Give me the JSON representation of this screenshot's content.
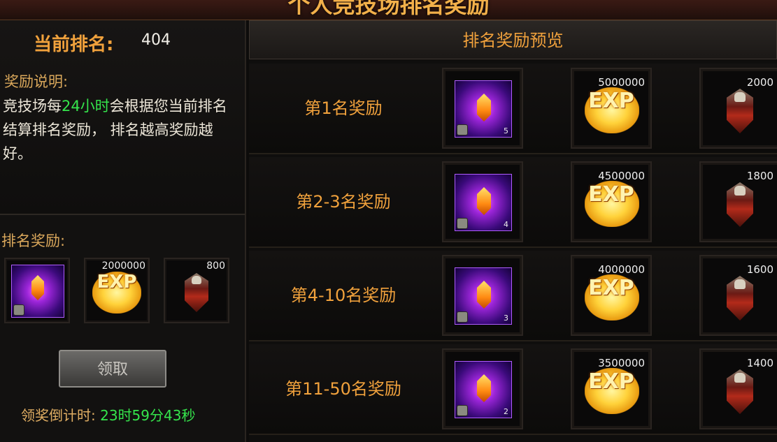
{
  "header": {
    "title": "个人竞技场排名奖励"
  },
  "left": {
    "rank_label": "当前排名:",
    "rank_value": "404",
    "desc_title": "奖励说明:",
    "desc_pre": "竞技场每",
    "desc_highlight": "24小时",
    "desc_post": "会根据您当前排名结算排名奖励， 排名越高奖励越好。",
    "reward_title": "排名奖励:",
    "rewards": {
      "gem_count": "",
      "exp": "2000000",
      "honor": "800"
    },
    "claim_label": "领取",
    "countdown_label": "领奖倒计时:",
    "countdown_value": "23时59分43秒"
  },
  "preview": {
    "title": "排名奖励预览",
    "rows": [
      {
        "label": "第1名奖励",
        "gem": "5",
        "exp": "5000000",
        "honor": "2000"
      },
      {
        "label": "第2-3名奖励",
        "gem": "4",
        "exp": "4500000",
        "honor": "1800"
      },
      {
        "label": "第4-10名奖励",
        "gem": "3",
        "exp": "4000000",
        "honor": "1600"
      },
      {
        "label": "第11-50名奖励",
        "gem": "2",
        "exp": "3500000",
        "honor": "1400"
      }
    ]
  },
  "icons": {
    "exp_text": "EXP"
  }
}
